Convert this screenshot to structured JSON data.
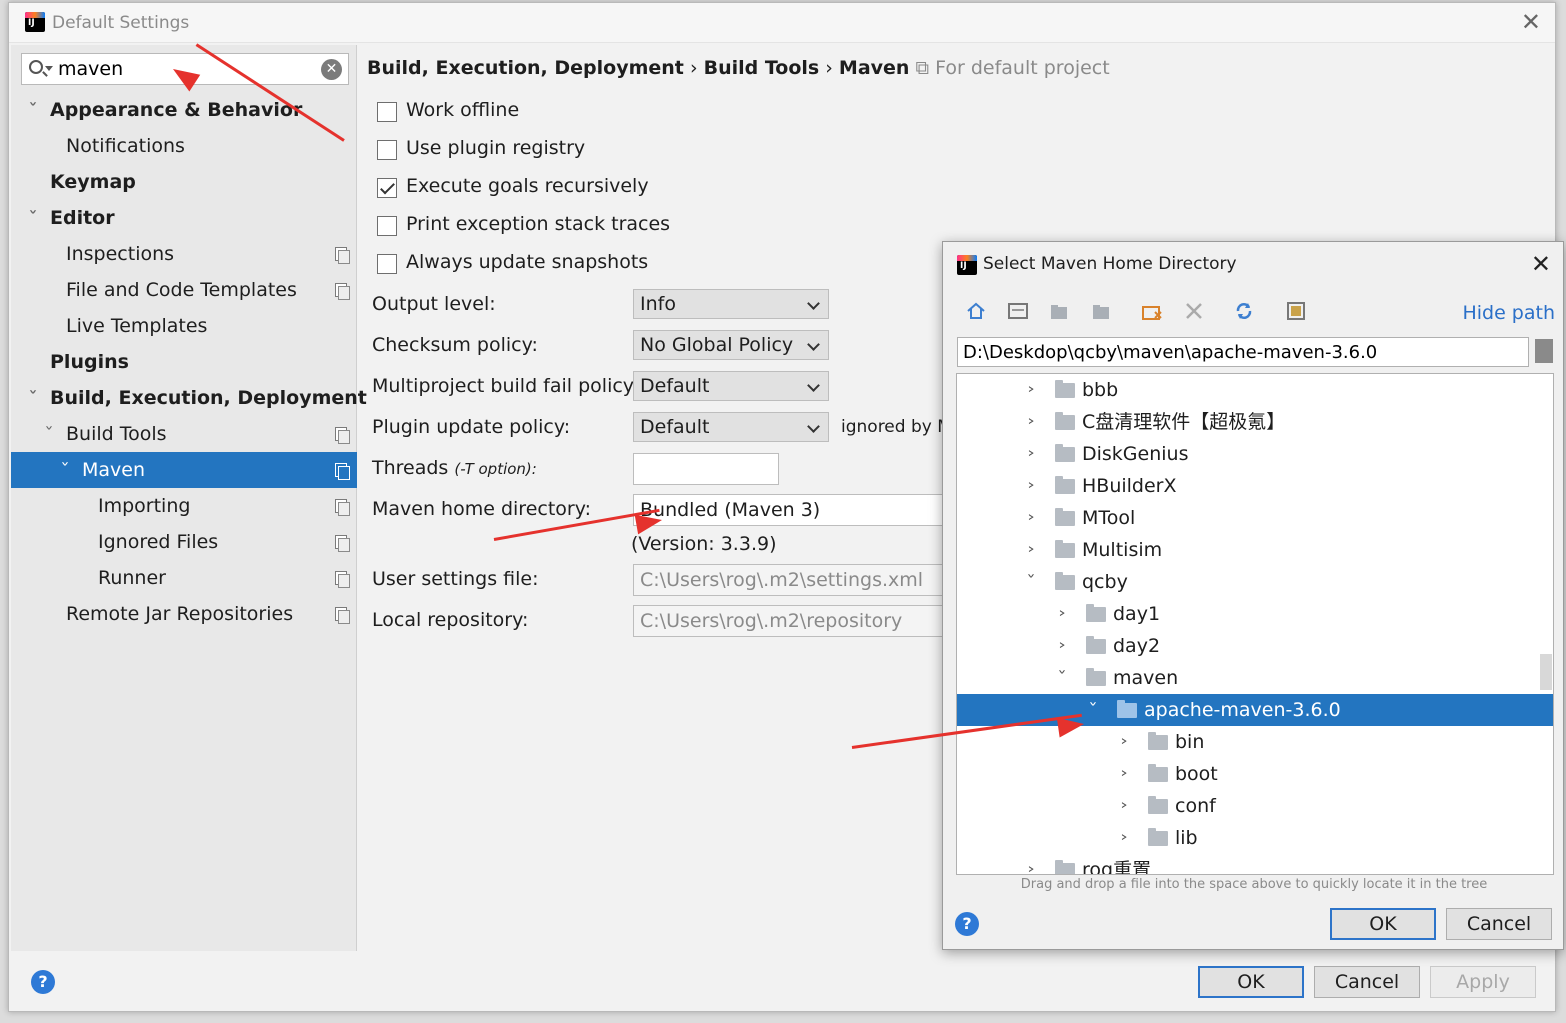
{
  "window": {
    "title": "Default Settings"
  },
  "search": {
    "value": "maven"
  },
  "sidebar": {
    "items": [
      {
        "label": "Appearance & Behavior"
      },
      {
        "label": "Notifications"
      },
      {
        "label": "Keymap"
      },
      {
        "label": "Editor"
      },
      {
        "label": "Inspections"
      },
      {
        "label": "File and Code Templates"
      },
      {
        "label": "Live Templates"
      },
      {
        "label": "Plugins"
      },
      {
        "label": "Build, Execution, Deployment"
      },
      {
        "label": "Build Tools"
      },
      {
        "label": "Maven"
      },
      {
        "label": "Importing"
      },
      {
        "label": "Ignored Files"
      },
      {
        "label": "Runner"
      },
      {
        "label": "Remote Jar Repositories"
      }
    ]
  },
  "breadcrumb": {
    "part1": "Build, Execution, Deployment",
    "sep": "›",
    "part2": "Build Tools",
    "part3": "Maven",
    "note": "For default project"
  },
  "maven": {
    "work_offline": "Work offline",
    "use_plugin_registry": "Use plugin registry",
    "execute_goals": "Execute goals recursively",
    "print_exception": "Print exception stack traces",
    "always_update": "Always update snapshots",
    "output_level_label": "Output level:",
    "output_level": "Info",
    "checksum_label": "Checksum policy:",
    "checksum": "No Global Policy",
    "multiproject_label": "Multiproject build fail policy:",
    "multiproject": "Default",
    "plugin_update_label": "Plugin update policy:",
    "plugin_update": "Default",
    "ignored_note": "ignored by M",
    "threads_label": "Threads",
    "threads_hint": "(-T option):",
    "threads": "",
    "home_label": "Maven home directory:",
    "home": "Bundled (Maven 3)",
    "version": "(Version: 3.3.9)",
    "user_settings_label": "User settings file:",
    "user_settings": "C:\\Users\\rog\\.m2\\settings.xml",
    "local_repo_label": "Local repository:",
    "local_repo": "C:\\Users\\rog\\.m2\\repository"
  },
  "buttons": {
    "ok": "OK",
    "cancel": "Cancel",
    "apply": "Apply"
  },
  "dialog": {
    "title": "Select Maven Home Directory",
    "hide_path": "Hide path",
    "path": "D:\\Deskdop\\qcby\\maven\\apache-maven-3.6.0",
    "hint": "Drag and drop a file into the space above to quickly locate it in the tree",
    "ok": "OK",
    "cancel": "Cancel",
    "tree": [
      {
        "name": "bbb"
      },
      {
        "name": "C盘清理软件【超极氪】"
      },
      {
        "name": "DiskGenius"
      },
      {
        "name": "HBuilderX"
      },
      {
        "name": "MTool"
      },
      {
        "name": "Multisim"
      },
      {
        "name": "qcby"
      },
      {
        "name": "day1"
      },
      {
        "name": "day2"
      },
      {
        "name": "maven"
      },
      {
        "name": "apache-maven-3.6.0"
      },
      {
        "name": "bin"
      },
      {
        "name": "boot"
      },
      {
        "name": "conf"
      },
      {
        "name": "lib"
      },
      {
        "name": "rog重置"
      }
    ]
  },
  "colors": {
    "selection": "#2375c0",
    "arrow": "#e5322d",
    "link": "#2a6fc8"
  }
}
